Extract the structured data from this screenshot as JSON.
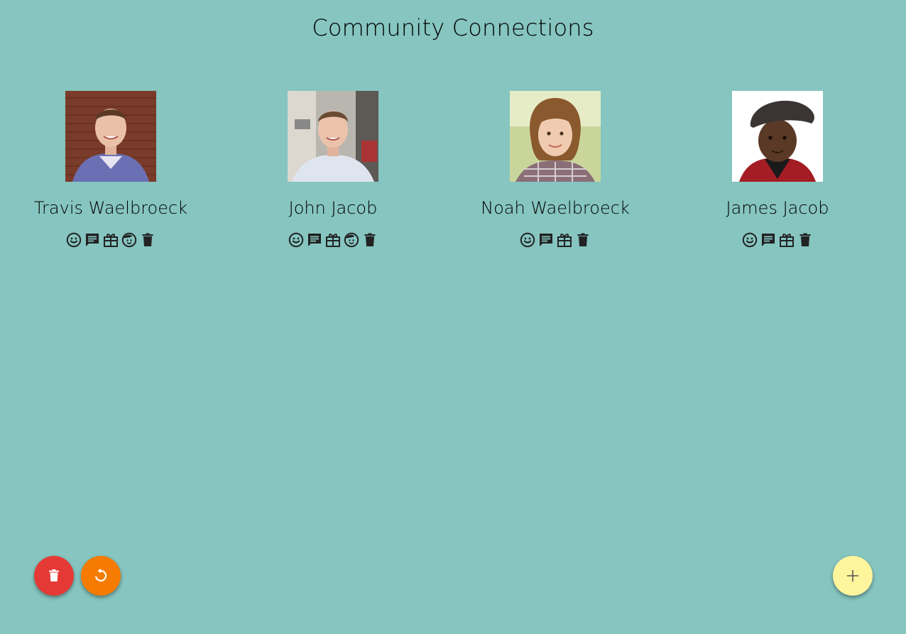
{
  "page": {
    "title": "Community Connections",
    "background_color": "#86c5c0"
  },
  "people": [
    {
      "name": "Travis Waelbroeck",
      "photo": "young man in checked shirt against brick wall",
      "actions": [
        "smiley-icon",
        "message-icon",
        "gift-icon",
        "child-icon",
        "trash-icon"
      ]
    },
    {
      "name": "John Jacob",
      "photo": "young man in light shirt on street",
      "actions": [
        "smiley-icon",
        "message-icon",
        "gift-icon",
        "child-icon",
        "trash-icon"
      ]
    },
    {
      "name": "Noah Waelbroeck",
      "photo": "smiling boy with brown hair",
      "actions": [
        "smiley-icon",
        "message-icon",
        "gift-icon",
        "trash-icon"
      ]
    },
    {
      "name": "James Jacob",
      "photo": "toddler wearing flat cap and red vest",
      "actions": [
        "smiley-icon",
        "message-icon",
        "gift-icon",
        "trash-icon"
      ]
    }
  ],
  "fabs": {
    "delete_all": {
      "icon": "trash-icon",
      "color": "#e53935"
    },
    "reset": {
      "icon": "reset-icon",
      "color": "#f57c00"
    },
    "add": {
      "icon": "plus-icon",
      "color": "#fff59d"
    }
  }
}
